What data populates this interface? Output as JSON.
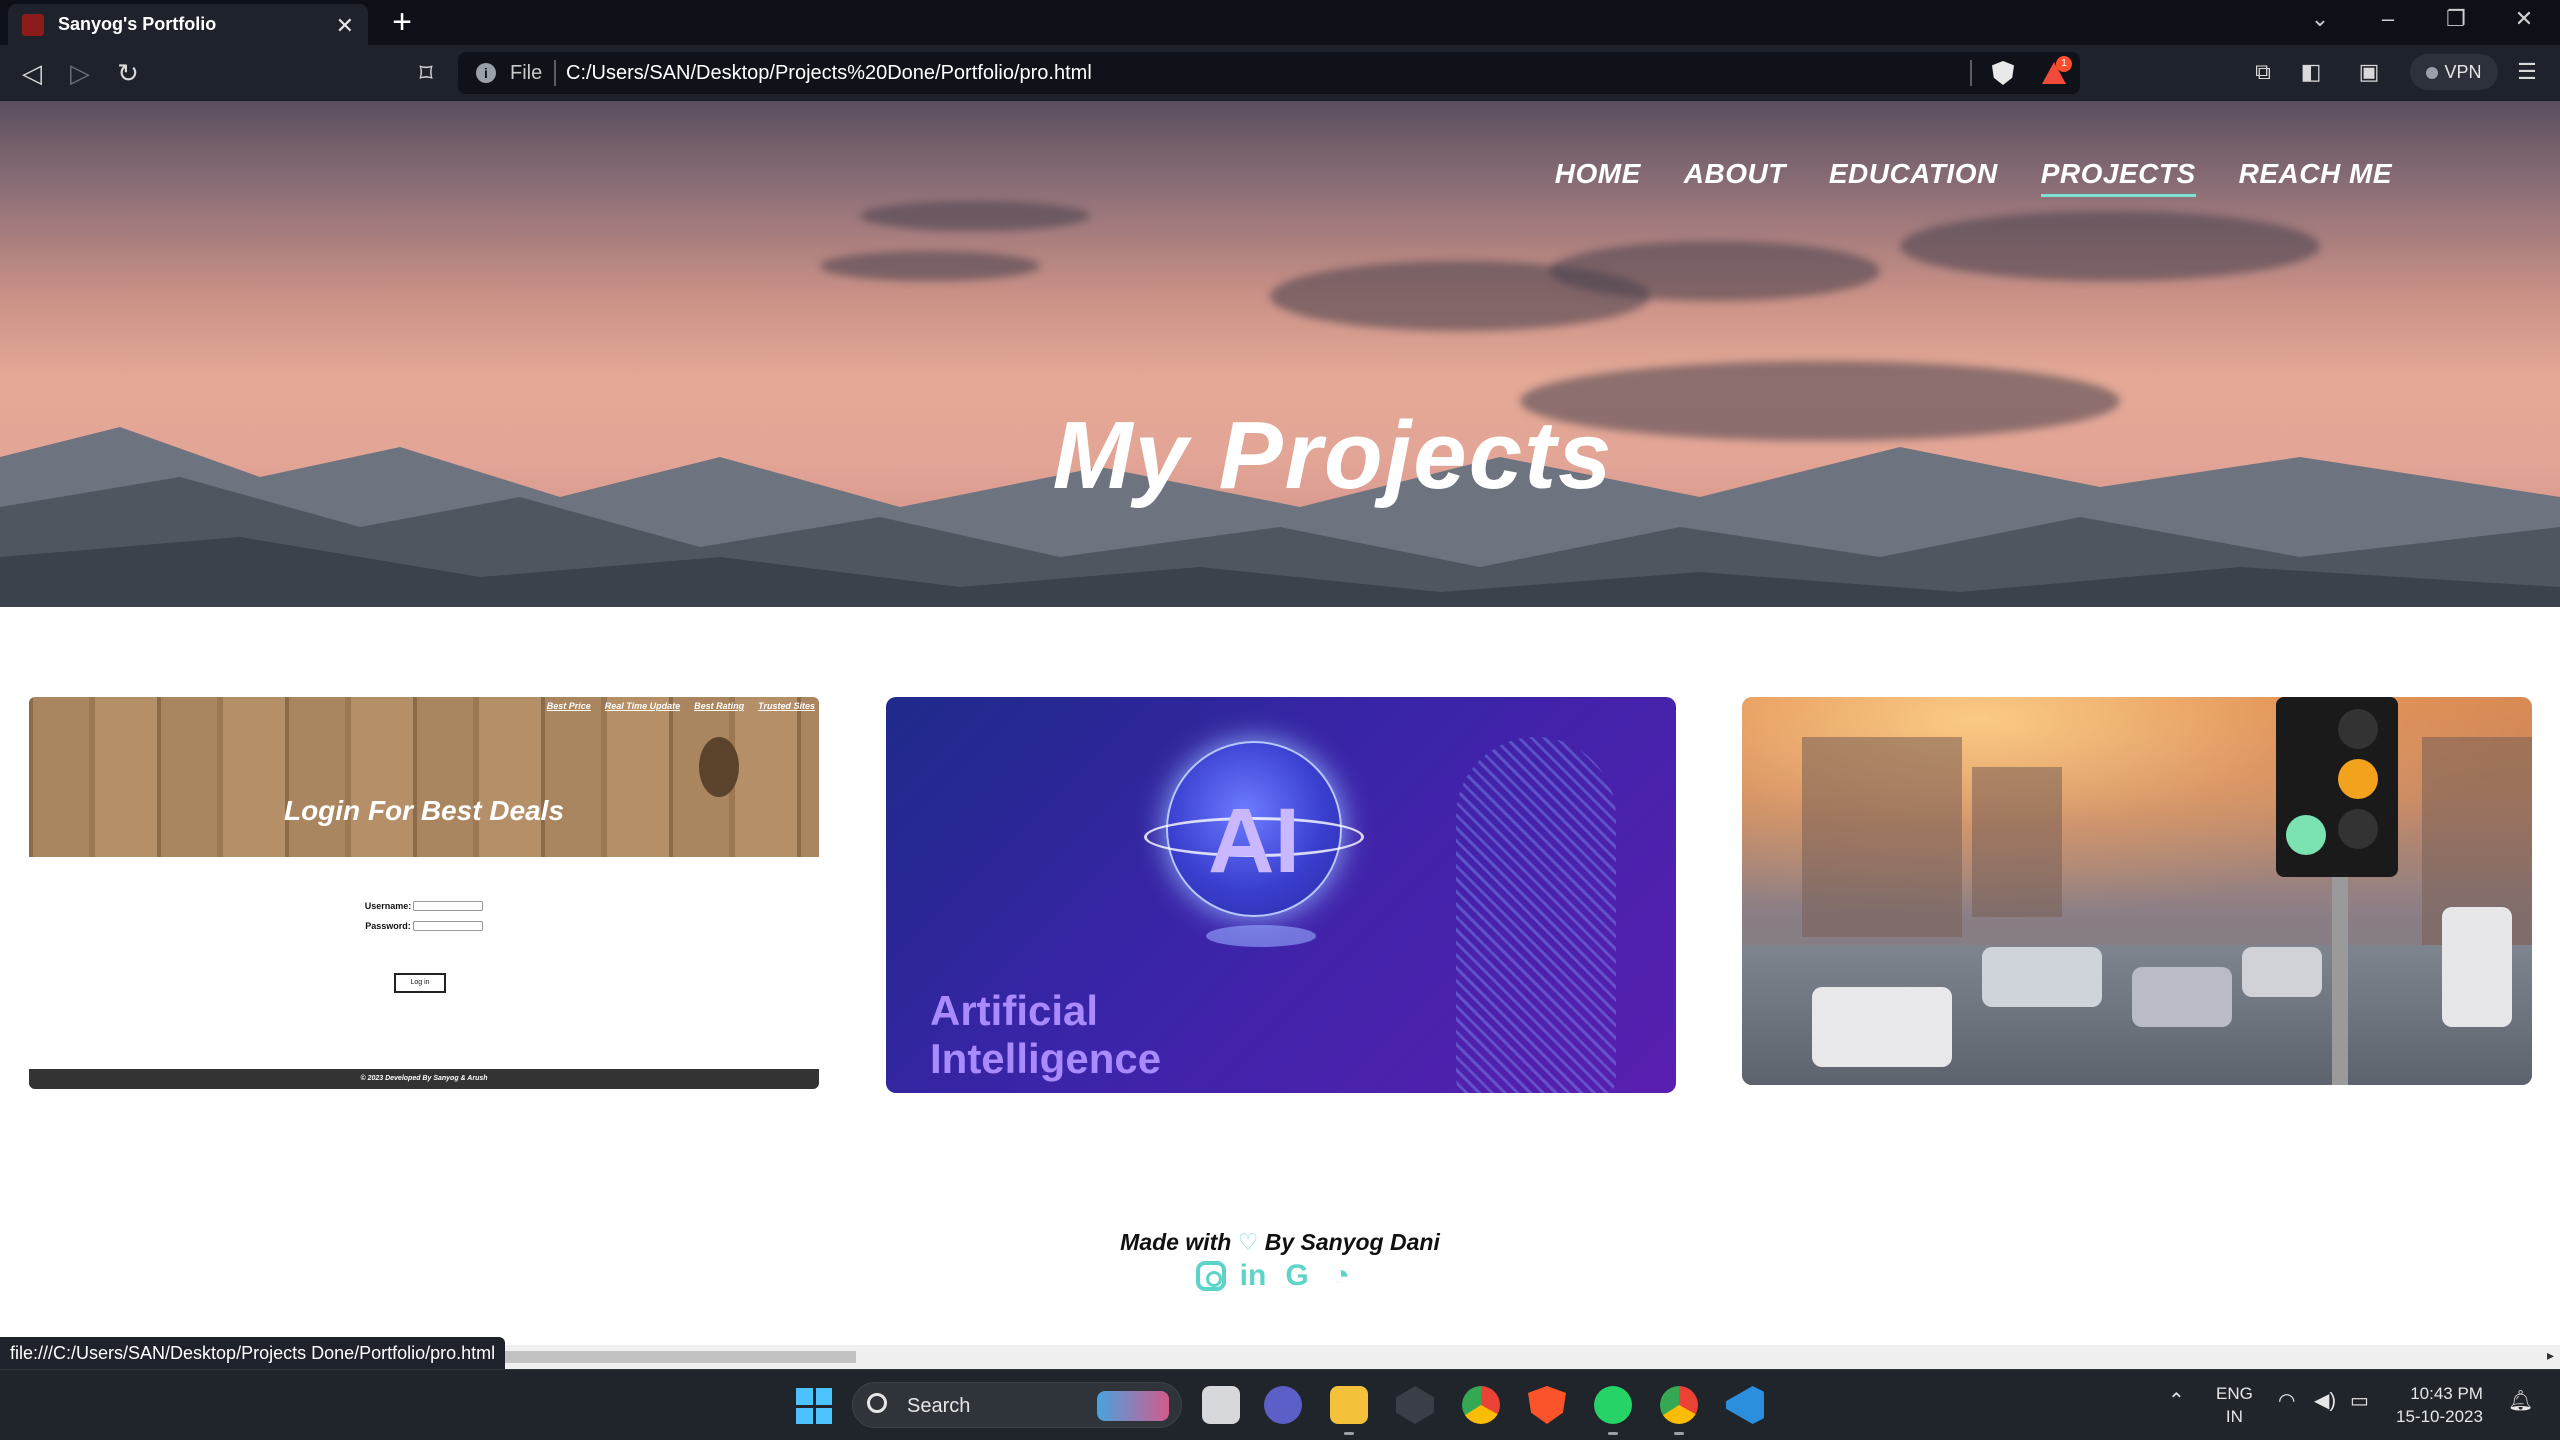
{
  "browser": {
    "tab_title": "Sanyog's Portfolio",
    "tab_close": "✕",
    "new_tab": "+",
    "scheme": "File",
    "url": "C:/Users/SAN/Desktop/Projects%20Done/Portfolio/pro.html",
    "rewards_badge": "1",
    "vpn_label": "VPN",
    "status_url": "file:///C:/Users/SAN/Desktop/Projects Done/Portfolio/pro.html"
  },
  "nav": {
    "items": [
      "HOME",
      "ABOUT",
      "EDUCATION",
      "PROJECTS",
      "REACH ME"
    ],
    "active": "PROJECTS"
  },
  "hero": {
    "title": "My Projects"
  },
  "projects": [
    {
      "name": "login-page",
      "links": [
        "Best Price",
        "Real Time Update",
        "Best Rating",
        "Trusted Sites"
      ],
      "banner": "Login For Best Deals",
      "username_label": "Username:",
      "password_label": "Password:",
      "button": "Log in",
      "footer": "© 2023 Developed By Sanyog & Arush"
    },
    {
      "name": "artificial-intelligence",
      "badge": "AI",
      "title_line1": "Artificial",
      "title_line2": "Intelligence"
    },
    {
      "name": "traffic"
    }
  ],
  "footer": {
    "made_with": "Made with",
    "heart": "♡",
    "by": "By Sanyog Dani",
    "socials": [
      "instagram-icon",
      "linkedin-icon",
      "google-icon",
      "github-icon"
    ]
  },
  "taskbar": {
    "search_label": "Search",
    "lang_line1": "ENG",
    "lang_line2": "IN",
    "time": "10:43 PM",
    "date": "15-10-2023"
  },
  "colors": {
    "accent": "#7fe0d6",
    "browser_dark": "#1e222b"
  }
}
